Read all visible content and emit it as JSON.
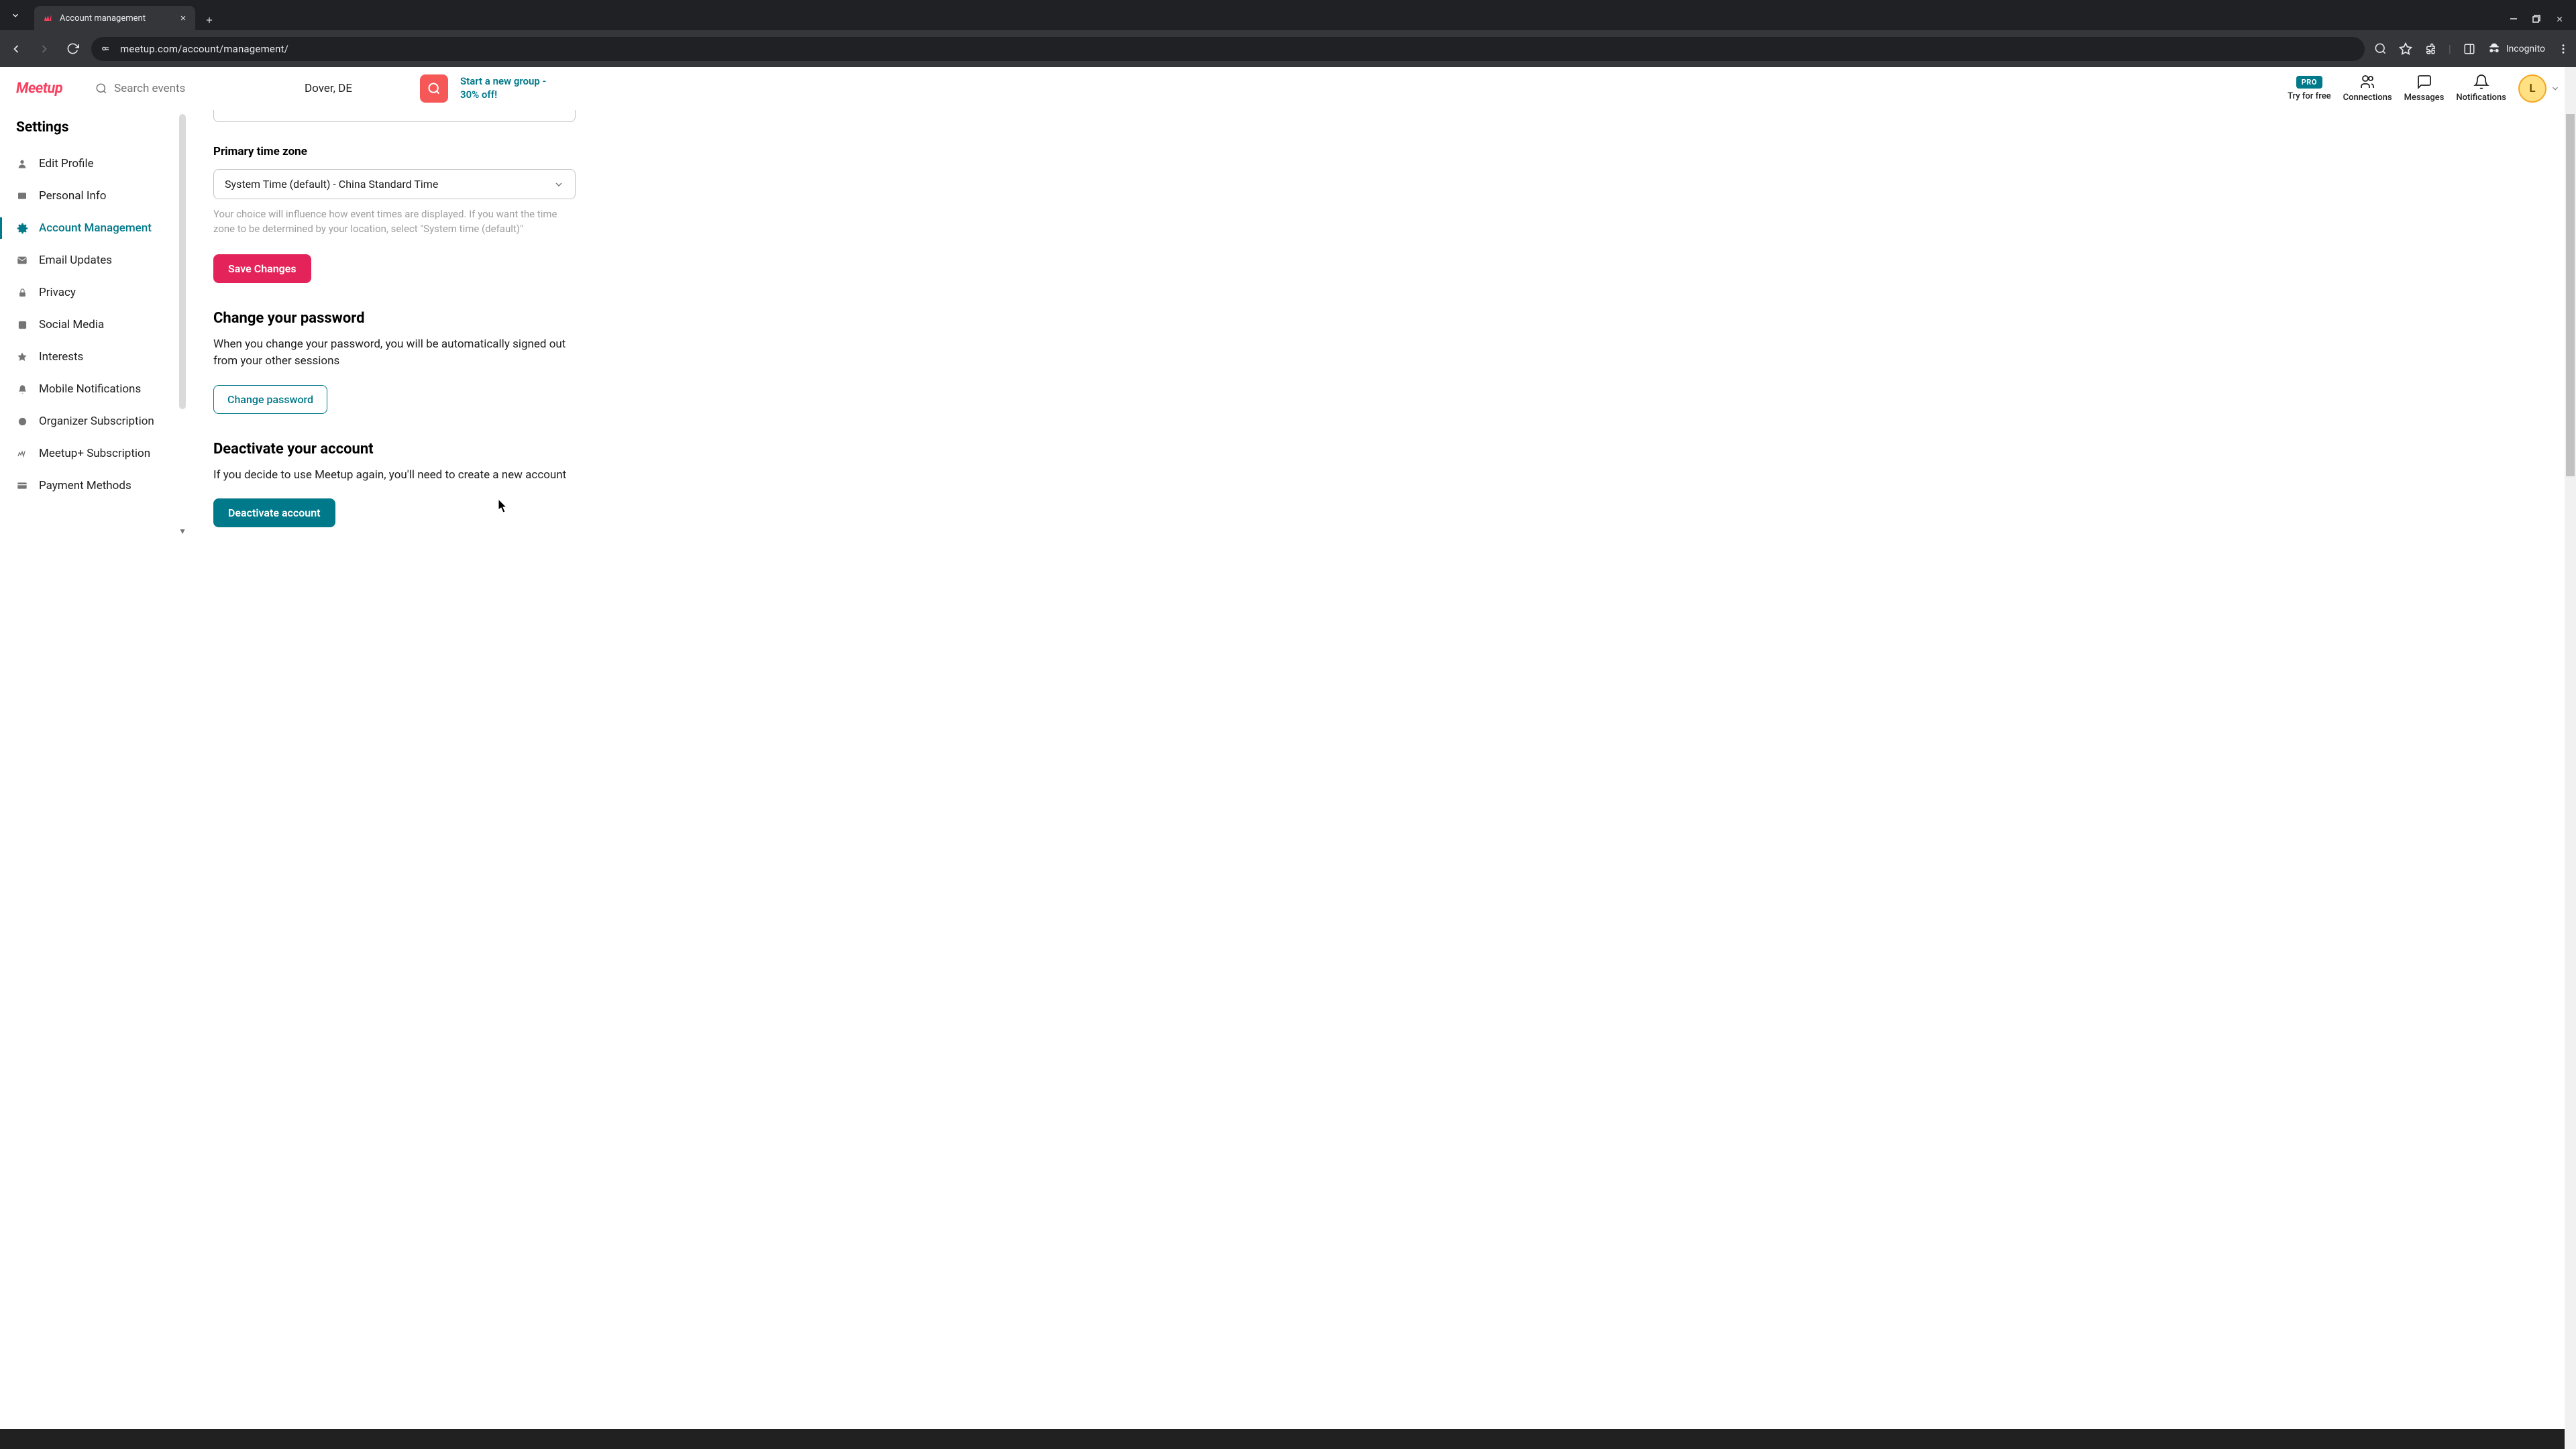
{
  "browser": {
    "tab_title": "Account management",
    "url": "meetup.com/account/management/",
    "incognito_label": "Incognito"
  },
  "header": {
    "logo_text": "Meetup",
    "search_placeholder": "Search events",
    "location": "Dover, DE",
    "promo_text": "Start a new group - 30% off!",
    "pro_badge": "PRO",
    "try_label": "Try for free",
    "connections_label": "Connections",
    "messages_label": "Messages",
    "notifications_label": "Notifications",
    "avatar_initial": "L"
  },
  "sidebar": {
    "title": "Settings",
    "items": [
      {
        "label": "Edit Profile"
      },
      {
        "label": "Personal Info"
      },
      {
        "label": "Account Management"
      },
      {
        "label": "Email Updates"
      },
      {
        "label": "Privacy"
      },
      {
        "label": "Social Media"
      },
      {
        "label": "Interests"
      },
      {
        "label": "Mobile Notifications"
      },
      {
        "label": "Organizer Subscription"
      },
      {
        "label": "Meetup+ Subscription"
      },
      {
        "label": "Payment Methods"
      }
    ]
  },
  "main": {
    "timezone_label": "Primary time zone",
    "timezone_value": "System Time (default) - China Standard Time",
    "timezone_help": "Your choice will influence how event times are displayed. If you want the time zone to be determined by your location, select \"System time (default)\"",
    "save_label": "Save Changes",
    "change_pw_heading": "Change your password",
    "change_pw_text": "When you change your password, you will be automatically signed out from your other sessions",
    "change_pw_btn": "Change password",
    "deactivate_heading": "Deactivate your account",
    "deactivate_text": "If you decide to use Meetup again, you'll need to create a new account",
    "deactivate_btn": "Deactivate account"
  }
}
